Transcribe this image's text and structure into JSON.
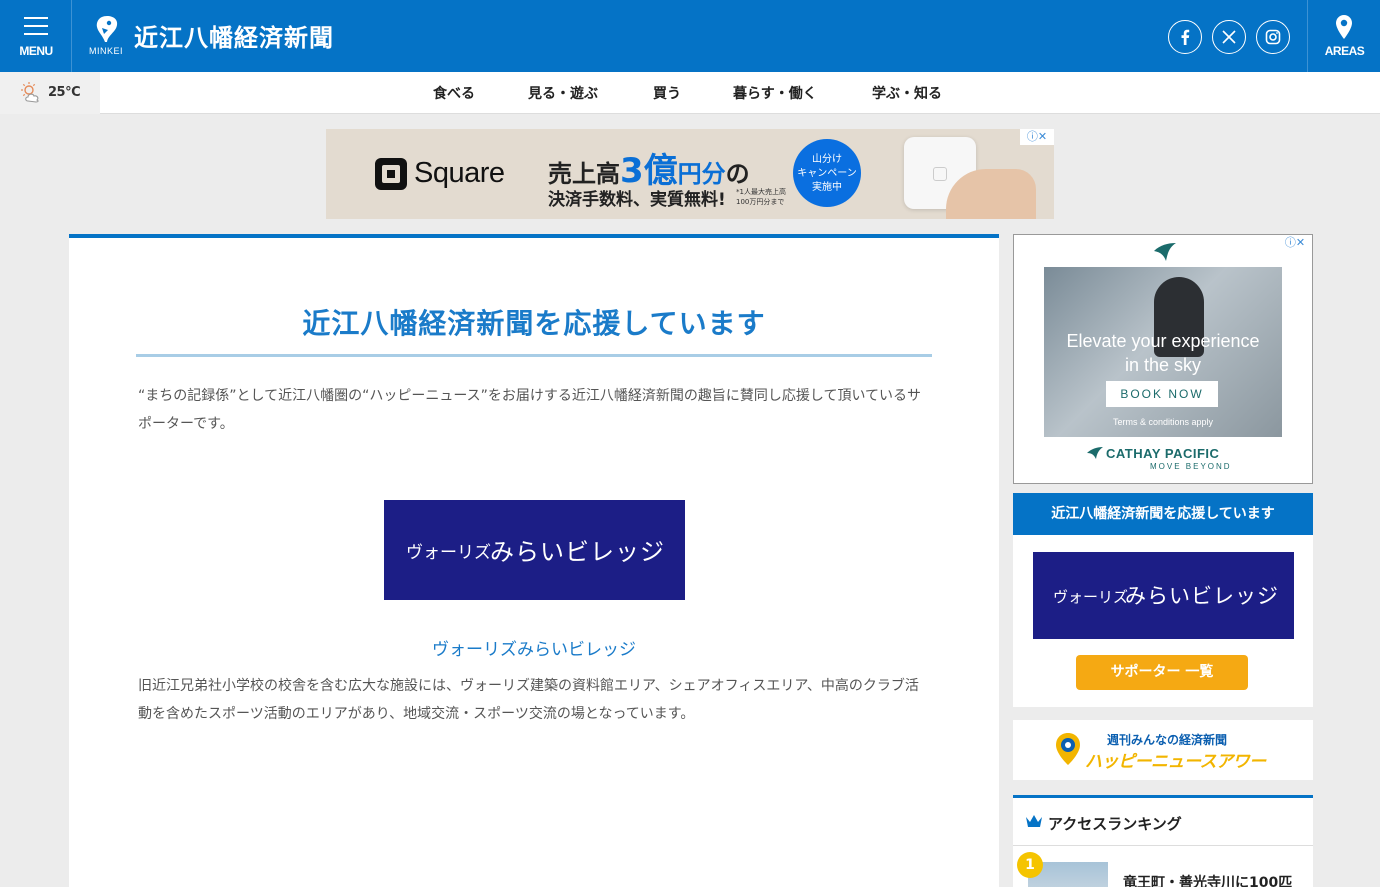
{
  "header": {
    "menu_label": "MENU",
    "logo_sub": "MINKEI",
    "site_title": "近江八幡経済新聞",
    "areas_label": "AREAS",
    "social": [
      "facebook-icon",
      "x-icon",
      "instagram-icon"
    ],
    "brand_color": "#0573c6"
  },
  "weather": {
    "temp": "25°C",
    "icon": "sun-cloud-icon"
  },
  "nav": {
    "items": [
      "食べる",
      "見る・遊ぶ",
      "買う",
      "暮らす・働く",
      "学ぶ・知る"
    ]
  },
  "ad_top": {
    "brand": "Square",
    "headline_pre": "売上高",
    "headline_num": "3",
    "headline_unit": "億",
    "headline_yen": "円分",
    "headline_post": "の",
    "subline": "決済手数料、実質無料!",
    "note": "*1人最大売上高100万円分まで",
    "badge_l1": "山分け",
    "badge_l2": "キャンペーン",
    "badge_l3": "実施中",
    "adchoices": "ⓘ✕"
  },
  "main": {
    "title": "近江八幡経済新聞を応援しています",
    "intro": "“まちの記録係”として近江八幡圏の“ハッピーニュース”をお届けする近江八幡経済新聞の趣旨に賛同し応援して頂いているサポーターです。",
    "supporter": {
      "banner_en": "ヴォーリズ",
      "banner_jp": "みらいビレッジ",
      "name": "ヴォーリズみらいビレッジ",
      "description": "旧近江兄弟社小学校の校舎を含む広大な施設には、ヴォーリズ建築の資料館エリア、シェアオフィスエリア、中高のクラブ活動を含めたスポーツ活動のエリアがあり、地域交流・スポーツ交流の場となっています。"
    }
  },
  "ad_side": {
    "line1": "Elevate your experience",
    "line2": "in the sky",
    "cta": "BOOK NOW",
    "terms": "Terms & conditions apply",
    "brand": "CATHAY PACIFIC",
    "tagline": "MOVE BEYOND",
    "adchoices": "ⓘ✕"
  },
  "sidebar": {
    "support_title": "近江八幡経済新聞を応援しています",
    "banner_en": "ヴォーリズ",
    "banner_jp": "みらいビレッジ",
    "list_button": "サポーター 一覧",
    "happy_line1": "週刊みんなの経済新聞",
    "happy_line2": "ハッピーニュースアワー",
    "ranking_title": "アクセスランキング",
    "ranking_items": [
      {
        "rank": "1",
        "title": "竜王町・善光寺川に100匹"
      }
    ]
  }
}
